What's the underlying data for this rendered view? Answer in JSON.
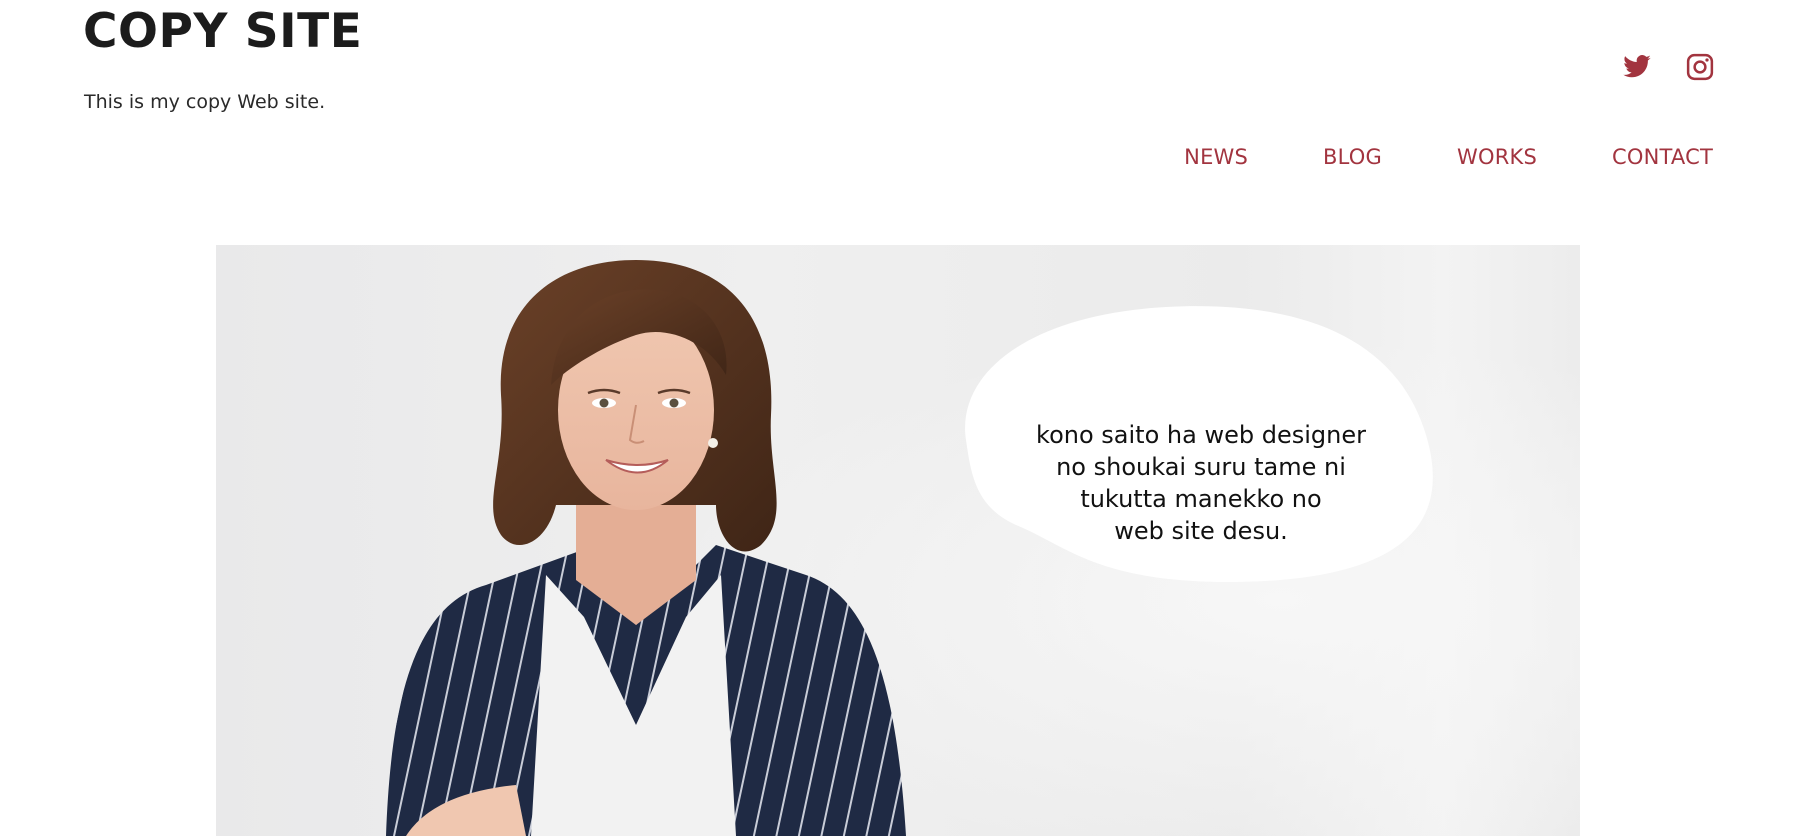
{
  "header": {
    "site_title": "COPY SITE",
    "tagline": "This is my copy Web site."
  },
  "social": {
    "twitter_icon": "twitter-icon",
    "instagram_icon": "instagram-icon",
    "color": "#a2343f"
  },
  "nav": {
    "items": [
      {
        "label": "NEWS"
      },
      {
        "label": "BLOG"
      },
      {
        "label": "WORKS"
      },
      {
        "label": "CONTACT"
      }
    ]
  },
  "hero": {
    "bubble_text": "kono saito ha web designer\nno shoukai  suru tame ni\ntukutta manekko no\nweb site desu."
  },
  "colors": {
    "accent": "#a2343f",
    "title": "#1c1c1c"
  }
}
